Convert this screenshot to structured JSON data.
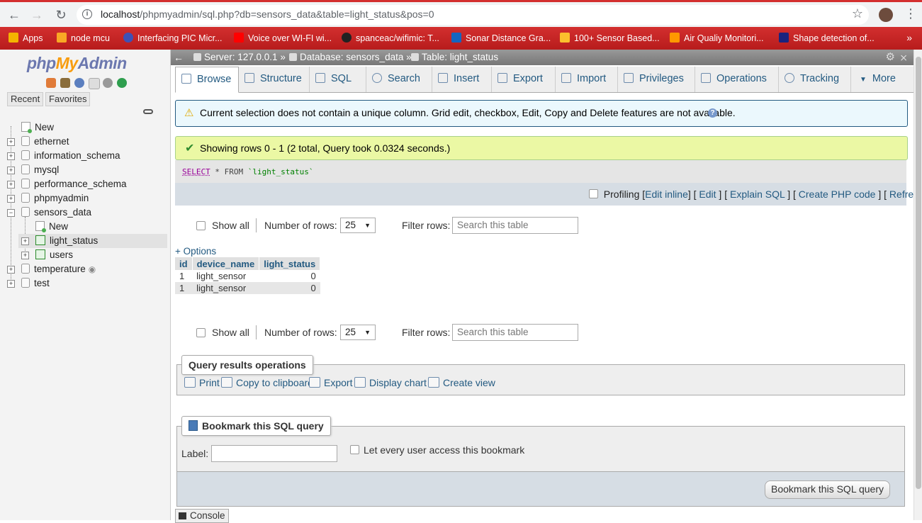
{
  "browser": {
    "url_host": "localhost",
    "url_path": "/phpmyadmin/sql.php?db=sensors_data&table=light_status&pos=0",
    "bookmarks": [
      {
        "label": "Apps",
        "color": "#f4b400"
      },
      {
        "label": "node mcu",
        "color": "#f9a825"
      },
      {
        "label": "Interfacing PIC Micr...",
        "color": "#3f51b5"
      },
      {
        "label": "Voice over WI-FI wi...",
        "color": "#ff0000"
      },
      {
        "label": "spanceac/wifimic: T...",
        "color": "#222222"
      },
      {
        "label": "Sonar Distance Gra...",
        "color": "#1565c0"
      },
      {
        "label": "100+ Sensor Based...",
        "color": "#fbc02d"
      },
      {
        "label": "Air Qualiy Monitori...",
        "color": "#ff9800"
      },
      {
        "label": "Shape detection of...",
        "color": "#1a237e"
      }
    ],
    "more": "»"
  },
  "sidebar": {
    "logo_php": "php",
    "logo_my": "My",
    "logo_admin": "Admin",
    "tabs": [
      "Recent",
      "Favorites"
    ],
    "tree": {
      "new": "New",
      "databases": [
        "ethernet",
        "information_schema",
        "mysql",
        "performance_schema",
        "phpmyadmin",
        "sensors_data"
      ],
      "sensors_children": [
        "New",
        "light_status",
        "users"
      ],
      "after": [
        "temperature",
        "test"
      ]
    }
  },
  "breadcrumb": {
    "server": "Server: 127.0.0.1",
    "database": "Database: sensors_data",
    "table": "Table: light_status",
    "separator": "»"
  },
  "tabs": [
    "Browse",
    "Structure",
    "SQL",
    "Search",
    "Insert",
    "Export",
    "Import",
    "Privileges",
    "Operations",
    "Tracking",
    "More"
  ],
  "notice": "Current selection does not contain a unique column. Grid edit, checkbox, Edit, Copy and Delete features are not available.",
  "success": "Showing rows 0 - 1 (2 total, Query took 0.0324 seconds.)",
  "sql": {
    "select": "SELECT",
    "rest": " * FROM ",
    "table": "`light_status`"
  },
  "sql_tools": {
    "profiling": "Profiling",
    "edit_inline": "Edit inline",
    "edit": "Edit",
    "explain": "Explain SQL",
    "create_php": "Create PHP code",
    "refresh": "Refresh"
  },
  "nav_controls": {
    "show_all": "Show all",
    "number_of_rows": "Number of rows:",
    "rows_value": "25",
    "filter_rows": "Filter rows:",
    "filter_placeholder": "Search this table"
  },
  "options_link": "+ Options",
  "results": {
    "columns": [
      "id",
      "device_name",
      "light_status"
    ],
    "rows": [
      [
        "1",
        "light_sensor",
        "0"
      ],
      [
        "1",
        "light_sensor",
        "0"
      ]
    ]
  },
  "query_ops": {
    "title": "Query results operations",
    "items": [
      "Print",
      "Copy to clipboard",
      "Export",
      "Display chart",
      "Create view"
    ]
  },
  "bookmark": {
    "title": "Bookmark this SQL query",
    "label": "Label:",
    "let_every_user": "Let every user access this bookmark",
    "button": "Bookmark this SQL query"
  },
  "console": "Console"
}
